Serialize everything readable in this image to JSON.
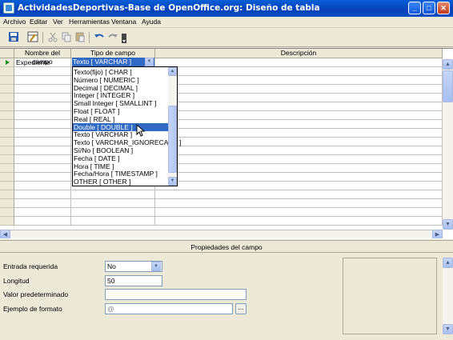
{
  "window": {
    "title": "ActividadesDeportivas-Base de OpenOffice.org: Diseño de tabla",
    "controls": [
      "_",
      "□",
      "✕"
    ]
  },
  "menu": [
    "Archivo",
    "Editar",
    "Ver",
    "Herramientas",
    "Ventana",
    "Ayuda"
  ],
  "toolbar": {
    "icons": [
      "save-icon",
      "table-index-icon",
      "cut-icon",
      "copy-icon",
      "paste-icon",
      "undo-icon",
      "redo-icon",
      "more-icon"
    ]
  },
  "grid": {
    "headers": [
      "Nombre del campo",
      "Tipo de campo",
      "Descripción"
    ],
    "rows": [
      {
        "name": "Expediente",
        "type": "Texto [ VARCHAR ]",
        "description": ""
      }
    ]
  },
  "dropdown": {
    "selected": "Double [ DOUBLE ]",
    "options": [
      "Texto(fijo) [ CHAR ]",
      "Número [ NUMERIC ]",
      "Decimal [ DECIMAL ]",
      "Integer [ INTEGER ]",
      "Small Integer [ SMALLINT ]",
      "Float [ FLOAT ]",
      "Real [ REAL ]",
      "Double [ DOUBLE ]",
      "Texto [ VARCHAR ]",
      "Texto [ VARCHAR_IGNORECASE ]",
      "Sí/No [ BOOLEAN ]",
      "Fecha [ DATE ]",
      "Hora [ TIME ]",
      "Fecha/Hora [ TIMESTAMP ]",
      "OTHER [ OTHER ]"
    ]
  },
  "properties": {
    "title": "Propiedades del campo",
    "entrada_label": "Entrada requerida",
    "entrada_value": "No",
    "longitud_label": "Longitud",
    "longitud_value": "50",
    "valor_label": "Valor predeterminado",
    "valor_value": "",
    "formato_label": "Ejemplo de formato",
    "formato_value": "@",
    "formato_button": "..."
  }
}
